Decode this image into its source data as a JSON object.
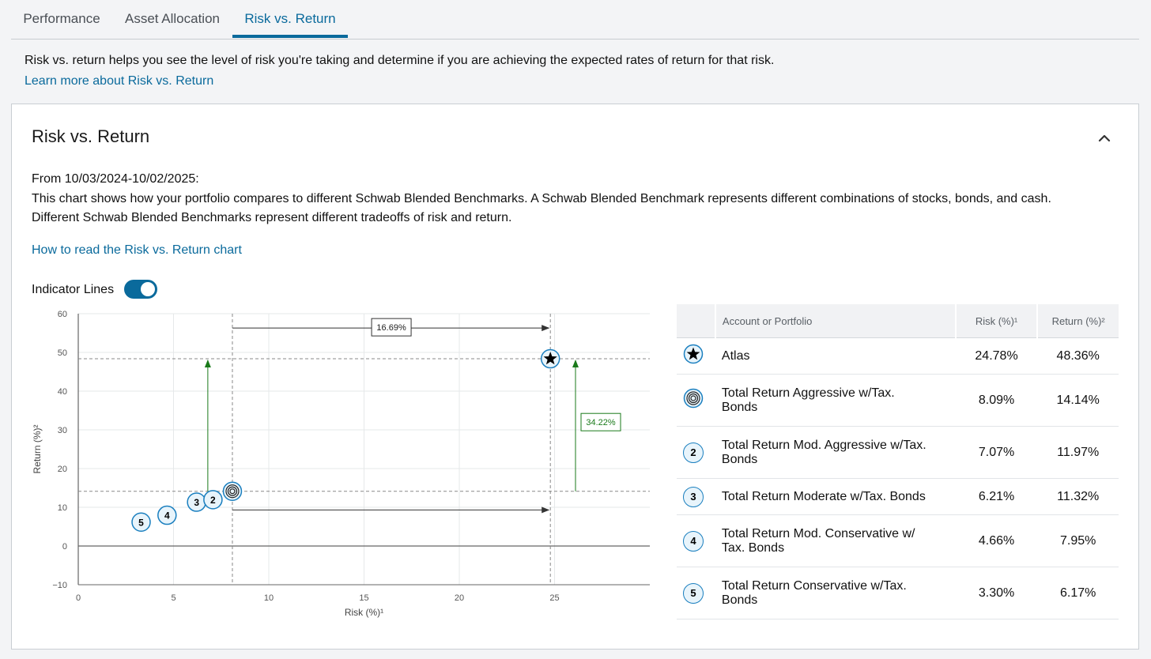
{
  "tabs": [
    {
      "label": "Performance",
      "active": false
    },
    {
      "label": "Asset Allocation",
      "active": false
    },
    {
      "label": "Risk vs. Return",
      "active": true
    }
  ],
  "intro": {
    "text": "Risk vs. return helps you see the level of risk you're taking and determine if you are achieving the expected rates of return for that risk.",
    "learn_more": "Learn more about Risk vs. Return"
  },
  "card": {
    "title": "Risk vs. Return",
    "collapse_icon": "chevron-up-icon",
    "period": "From 10/03/2024-10/02/2025:",
    "desc_line1": "This chart shows how your portfolio compares to different Schwab Blended Benchmarks. A Schwab Blended Benchmark represents different combinations of stocks, bonds, and cash.",
    "desc_line2": "Different Schwab Blended Benchmarks represent different tradeoffs of risk and return.",
    "how_to": "How to read the Risk vs. Return chart",
    "toggle_label": "Indicator Lines",
    "toggle_on": true
  },
  "chart_data": {
    "type": "scatter",
    "xlabel": "Risk (%)¹",
    "ylabel": "Return (%)²",
    "xlim": [
      0,
      30
    ],
    "ylim": [
      -10,
      60
    ],
    "xticks": [
      0,
      5,
      10,
      15,
      20,
      25
    ],
    "yticks": [
      -10,
      0,
      10,
      20,
      30,
      40,
      50,
      60
    ],
    "points": [
      {
        "label": "Atlas",
        "marker": "star",
        "x": 24.78,
        "y": 48.36
      },
      {
        "label": "Total Return Aggressive w/Tax. Bonds",
        "marker": "target",
        "x": 8.09,
        "y": 14.14
      },
      {
        "label": "Total Return Mod. Aggressive w/Tax. Bonds",
        "marker": "2",
        "x": 7.07,
        "y": 11.97
      },
      {
        "label": "Total Return Moderate w/Tax. Bonds",
        "marker": "3",
        "x": 6.21,
        "y": 11.32
      },
      {
        "label": "Total Return Mod. Conservative w/ Tax. Bonds",
        "marker": "4",
        "x": 4.66,
        "y": 7.95
      },
      {
        "label": "Total Return Conservative w/Tax. Bonds",
        "marker": "5",
        "x": 3.3,
        "y": 6.17
      }
    ],
    "indicators": {
      "risk_diff": "16.69%",
      "return_diff": "34.22%",
      "accent": "#1a7a1a",
      "line_color": "#333333"
    }
  },
  "table": {
    "headers": [
      "",
      "Account or Portfolio",
      "Risk (%)¹",
      "Return (%)²"
    ],
    "rows": [
      {
        "icon": "star-icon",
        "marker": "",
        "name_line1": "Atlas",
        "name_line2": "",
        "risk": "24.78%",
        "ret": "48.36%"
      },
      {
        "icon": "target-icon",
        "marker": "",
        "name_line1": "Total Return Aggressive w/Tax.",
        "name_line2": "Bonds",
        "risk": "8.09%",
        "ret": "14.14%"
      },
      {
        "icon": "number-2-icon",
        "marker": "2",
        "name_line1": "Total Return Mod. Aggressive w/Tax.",
        "name_line2": "Bonds",
        "risk": "7.07%",
        "ret": "11.97%"
      },
      {
        "icon": "number-3-icon",
        "marker": "3",
        "name_line1": "Total Return Moderate w/Tax. Bonds",
        "name_line2": "",
        "risk": "6.21%",
        "ret": "11.32%"
      },
      {
        "icon": "number-4-icon",
        "marker": "4",
        "name_line1": "Total Return Mod. Conservative w/",
        "name_line2": "Tax. Bonds",
        "risk": "4.66%",
        "ret": "7.95%"
      },
      {
        "icon": "number-5-icon",
        "marker": "5",
        "name_line1": "Total Return Conservative w/Tax.",
        "name_line2": "Bonds",
        "risk": "3.30%",
        "ret": "6.17%"
      }
    ]
  },
  "colors": {
    "accent": "#0a6a9c",
    "marker_border": "#1a7fbf",
    "marker_fill": "#e8f4fb"
  }
}
